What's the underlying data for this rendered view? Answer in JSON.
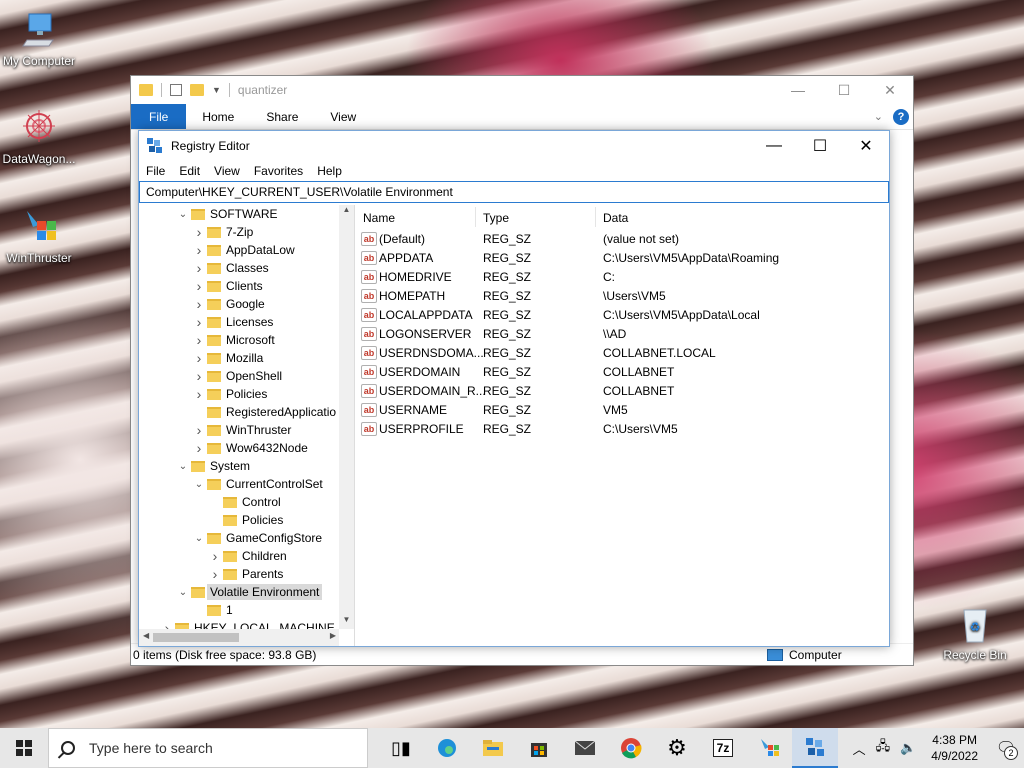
{
  "desktop": {
    "icons": [
      {
        "label": "My Computer"
      },
      {
        "label": "DataWagon..."
      },
      {
        "label": "WinThruster"
      },
      {
        "label": "Recycle Bin"
      }
    ]
  },
  "explorer": {
    "title": "quantizer",
    "tabs": [
      "File",
      "Home",
      "Share",
      "View"
    ],
    "status": "0 items (Disk free space: 93.8 GB)",
    "status_right": "Computer",
    "controls": {
      "minimize": "—",
      "maximize": "☐",
      "close": "✕"
    }
  },
  "regedit": {
    "title": "Registry Editor",
    "menu": [
      "File",
      "Edit",
      "View",
      "Favorites",
      "Help"
    ],
    "address": "Computer\\HKEY_CURRENT_USER\\Volatile Environment",
    "controls": {
      "minimize": "—",
      "maximize": "☐",
      "close": "✕"
    },
    "tree": [
      {
        "label": "SOFTWARE",
        "level": 0,
        "state": "open"
      },
      {
        "label": "7-Zip",
        "level": 1,
        "state": "closed"
      },
      {
        "label": "AppDataLow",
        "level": 1,
        "state": "closed"
      },
      {
        "label": "Classes",
        "level": 1,
        "state": "closed"
      },
      {
        "label": "Clients",
        "level": 1,
        "state": "closed"
      },
      {
        "label": "Google",
        "level": 1,
        "state": "closed"
      },
      {
        "label": "Licenses",
        "level": 1,
        "state": "closed"
      },
      {
        "label": "Microsoft",
        "level": 1,
        "state": "closed"
      },
      {
        "label": "Mozilla",
        "level": 1,
        "state": "closed"
      },
      {
        "label": "OpenShell",
        "level": 1,
        "state": "closed"
      },
      {
        "label": "Policies",
        "level": 1,
        "state": "closed"
      },
      {
        "label": "RegisteredApplicatio",
        "level": 1,
        "state": "none"
      },
      {
        "label": "WinThruster",
        "level": 1,
        "state": "closed"
      },
      {
        "label": "Wow6432Node",
        "level": 1,
        "state": "closed"
      },
      {
        "label": "System",
        "level": 0,
        "state": "open"
      },
      {
        "label": "CurrentControlSet",
        "level": 1,
        "state": "open"
      },
      {
        "label": "Control",
        "level": 2,
        "state": "none"
      },
      {
        "label": "Policies",
        "level": 2,
        "state": "none"
      },
      {
        "label": "GameConfigStore",
        "level": 1,
        "state": "open"
      },
      {
        "label": "Children",
        "level": 2,
        "state": "closed"
      },
      {
        "label": "Parents",
        "level": 2,
        "state": "closed"
      },
      {
        "label": "Volatile Environment",
        "level": 0,
        "state": "open",
        "selected": true
      },
      {
        "label": "1",
        "level": 1,
        "state": "none"
      },
      {
        "label": "HKEY_LOCAL_MACHINE",
        "level": -1,
        "state": "closed"
      }
    ],
    "columns": [
      "Name",
      "Type",
      "Data"
    ],
    "values": [
      {
        "name": "(Default)",
        "type": "REG_SZ",
        "data": "(value not set)"
      },
      {
        "name": "APPDATA",
        "type": "REG_SZ",
        "data": "C:\\Users\\VM5\\AppData\\Roaming"
      },
      {
        "name": "HOMEDRIVE",
        "type": "REG_SZ",
        "data": "C:"
      },
      {
        "name": "HOMEPATH",
        "type": "REG_SZ",
        "data": "\\Users\\VM5"
      },
      {
        "name": "LOCALAPPDATA",
        "type": "REG_SZ",
        "data": "C:\\Users\\VM5\\AppData\\Local"
      },
      {
        "name": "LOGONSERVER",
        "type": "REG_SZ",
        "data": "\\\\AD"
      },
      {
        "name": "USERDNSDOMA...",
        "type": "REG_SZ",
        "data": "COLLABNET.LOCAL"
      },
      {
        "name": "USERDOMAIN",
        "type": "REG_SZ",
        "data": "COLLABNET"
      },
      {
        "name": "USERDOMAIN_R...",
        "type": "REG_SZ",
        "data": "COLLABNET"
      },
      {
        "name": "USERNAME",
        "type": "REG_SZ",
        "data": "VM5"
      },
      {
        "name": "USERPROFILE",
        "type": "REG_SZ",
        "data": "C:\\Users\\VM5"
      }
    ],
    "value_icon_text": "ab"
  },
  "taskbar": {
    "search_placeholder": "Type here to search",
    "time": "4:38 PM",
    "date": "4/9/2022",
    "notification_count": "2",
    "icons": [
      "task-view-icon",
      "edge-icon",
      "file-explorer-icon",
      "store-icon",
      "mail-icon",
      "chrome-icon",
      "settings-icon",
      "7zip-icon",
      "winthruster-icon",
      "regedit-icon"
    ],
    "zip_label": "7z"
  },
  "colors": {
    "accent": "#2b7bd0",
    "file_tab": "#1a6cc4",
    "folder": "#f5cf5a"
  }
}
